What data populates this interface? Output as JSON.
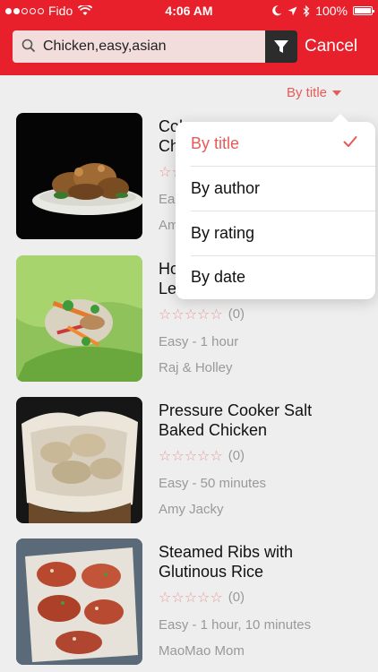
{
  "status_bar": {
    "carrier": "Fido",
    "time": "4:06 AM",
    "battery": "100%"
  },
  "search": {
    "query": "Chicken,easy,asian",
    "cancel_label": "Cancel"
  },
  "sort": {
    "current_label": "By title",
    "options": [
      {
        "label": "By title",
        "selected": true
      },
      {
        "label": "By author",
        "selected": false
      },
      {
        "label": "By rating",
        "selected": false
      },
      {
        "label": "By date",
        "selected": false
      }
    ]
  },
  "recipes": [
    {
      "title": "Cola Pressure Cooker Chicken Wings",
      "title_visible_line1": "Col",
      "title_visible_line2": "Ch",
      "rating_text": "",
      "meta": "Ea",
      "author": "Am"
    },
    {
      "title": "Honey Chicken Lettuce Wraps",
      "title_visible_line1": "Ho",
      "title_visible_line2": "Le",
      "rating_text": "(0)",
      "meta": "Easy - 1 hour",
      "author": "Raj & Holley"
    },
    {
      "title": "Pressure Cooker Salt Baked Chicken",
      "title_visible_line1": "Pressure Cooker Salt",
      "title_visible_line2": "Baked Chicken",
      "rating_text": "(0)",
      "meta": "Easy - 50 minutes",
      "author": "Amy Jacky"
    },
    {
      "title": "Steamed Ribs with Glutinous Rice",
      "title_visible_line1": "Steamed Ribs with",
      "title_visible_line2": "Glutinous Rice",
      "rating_text": "(0)",
      "meta": "Easy - 1 hour, 10 minutes",
      "author": "MaoMao Mom"
    }
  ],
  "rating_stars": "☆☆☆☆☆",
  "icons": {
    "search": "search-icon",
    "filter": "filter-icon",
    "check": "checkmark-icon",
    "caret": "caret-down-icon"
  },
  "colors": {
    "brand_red": "#e8202b",
    "accent": "#e85a5a",
    "background": "#eeeeee"
  }
}
